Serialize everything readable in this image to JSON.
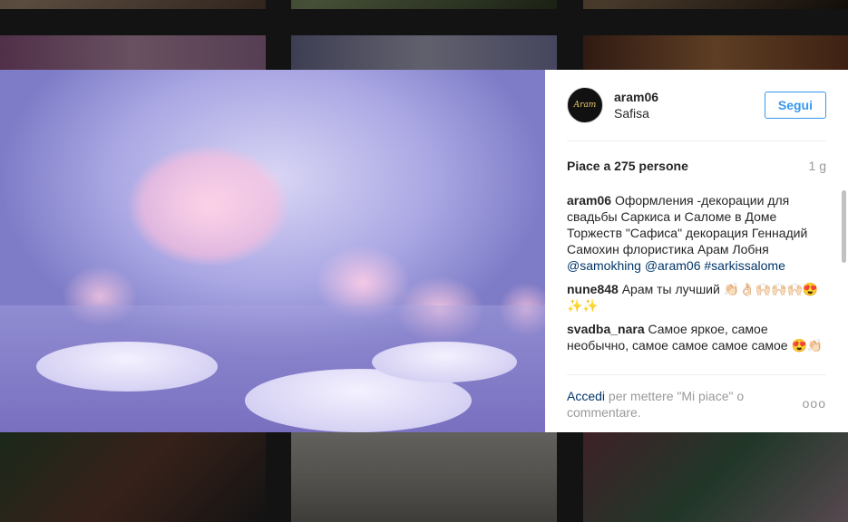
{
  "post": {
    "avatar_text": "Aram",
    "username": "aram06",
    "location": "Safisa",
    "follow_label": "Segui",
    "likes": "Piace a 275 persone",
    "time": "1 g"
  },
  "caption": {
    "user": "aram06",
    "text": "Оформления -декорации для свадьбы Саркиса и Саломе в Доме Торжеств \"Сафиса\" декорация Геннадий Самохин флористика Арам Лобня ",
    "mention1": "@samokhing",
    "mention2": "@aram06",
    "hashtag": "#sarkissalome"
  },
  "comments": [
    {
      "user": "nune848",
      "text": "Арам ты лучший 👏🏻👌🏻🙌🏻🙌🏻🙌🏻😍✨✨"
    },
    {
      "user": "svadba_nara",
      "text": "Самое яркое, самое необычно, самое самое самое самое 😍👏🏻"
    }
  ],
  "footer": {
    "login_link": "Accedi",
    "text": " per mettere \"Mi piace\" o commentare.",
    "more_icon": "ooo"
  },
  "colors": {
    "accent": "#3897f0",
    "link": "#003569",
    "muted": "#999999"
  }
}
